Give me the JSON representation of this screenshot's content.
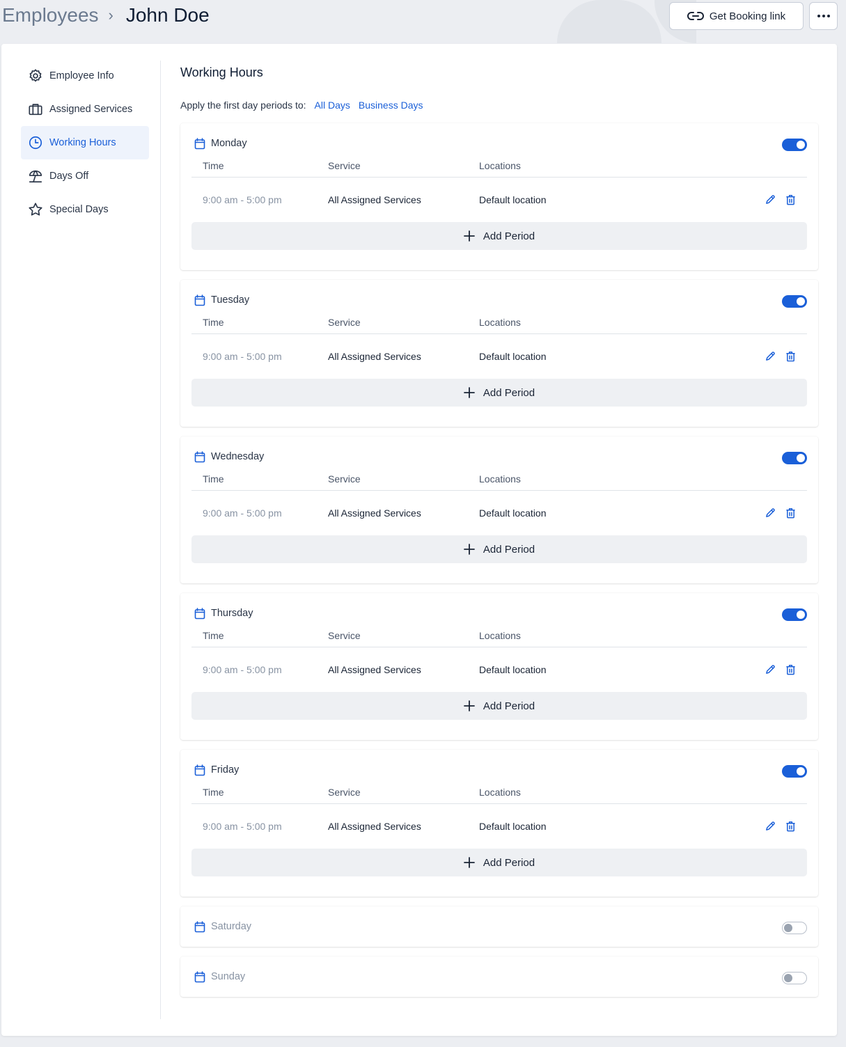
{
  "breadcrumb": {
    "parent": "Employees",
    "separator": "›",
    "current": "John Doe"
  },
  "header": {
    "booking_label": "Get Booking link",
    "more_label": "•••"
  },
  "sidebar": {
    "items": [
      {
        "label": "Employee Info",
        "icon": "gear-icon",
        "active": false
      },
      {
        "label": "Assigned Services",
        "icon": "briefcase-icon",
        "active": false
      },
      {
        "label": "Working Hours",
        "icon": "clock-icon",
        "active": true
      },
      {
        "label": "Days Off",
        "icon": "beach-umbrella-icon",
        "active": false
      },
      {
        "label": "Special Days",
        "icon": "star-icon",
        "active": false
      }
    ]
  },
  "main": {
    "title": "Working Hours",
    "apply_label": "Apply the first day periods to:",
    "apply_all": "All Days",
    "apply_business": "Business Days",
    "columns": {
      "time": "Time",
      "service": "Service",
      "locations": "Locations"
    },
    "add_period_label": "Add Period",
    "days": [
      {
        "name": "Monday",
        "enabled": true,
        "periods": [
          {
            "time": "9:00 am - 5:00 pm",
            "service": "All Assigned Services",
            "location": "Default location"
          }
        ]
      },
      {
        "name": "Tuesday",
        "enabled": true,
        "periods": [
          {
            "time": "9:00 am - 5:00 pm",
            "service": "All Assigned Services",
            "location": "Default location"
          }
        ]
      },
      {
        "name": "Wednesday",
        "enabled": true,
        "periods": [
          {
            "time": "9:00 am - 5:00 pm",
            "service": "All Assigned Services",
            "location": "Default location"
          }
        ]
      },
      {
        "name": "Thursday",
        "enabled": true,
        "periods": [
          {
            "time": "9:00 am - 5:00 pm",
            "service": "All Assigned Services",
            "location": "Default location"
          }
        ]
      },
      {
        "name": "Friday",
        "enabled": true,
        "periods": [
          {
            "time": "9:00 am - 5:00 pm",
            "service": "All Assigned Services",
            "location": "Default location"
          }
        ]
      },
      {
        "name": "Saturday",
        "enabled": false,
        "periods": []
      },
      {
        "name": "Sunday",
        "enabled": false,
        "periods": []
      }
    ]
  },
  "colors": {
    "accent": "#1a5fd8",
    "muted": "#8893a3",
    "background": "#eceef2"
  }
}
